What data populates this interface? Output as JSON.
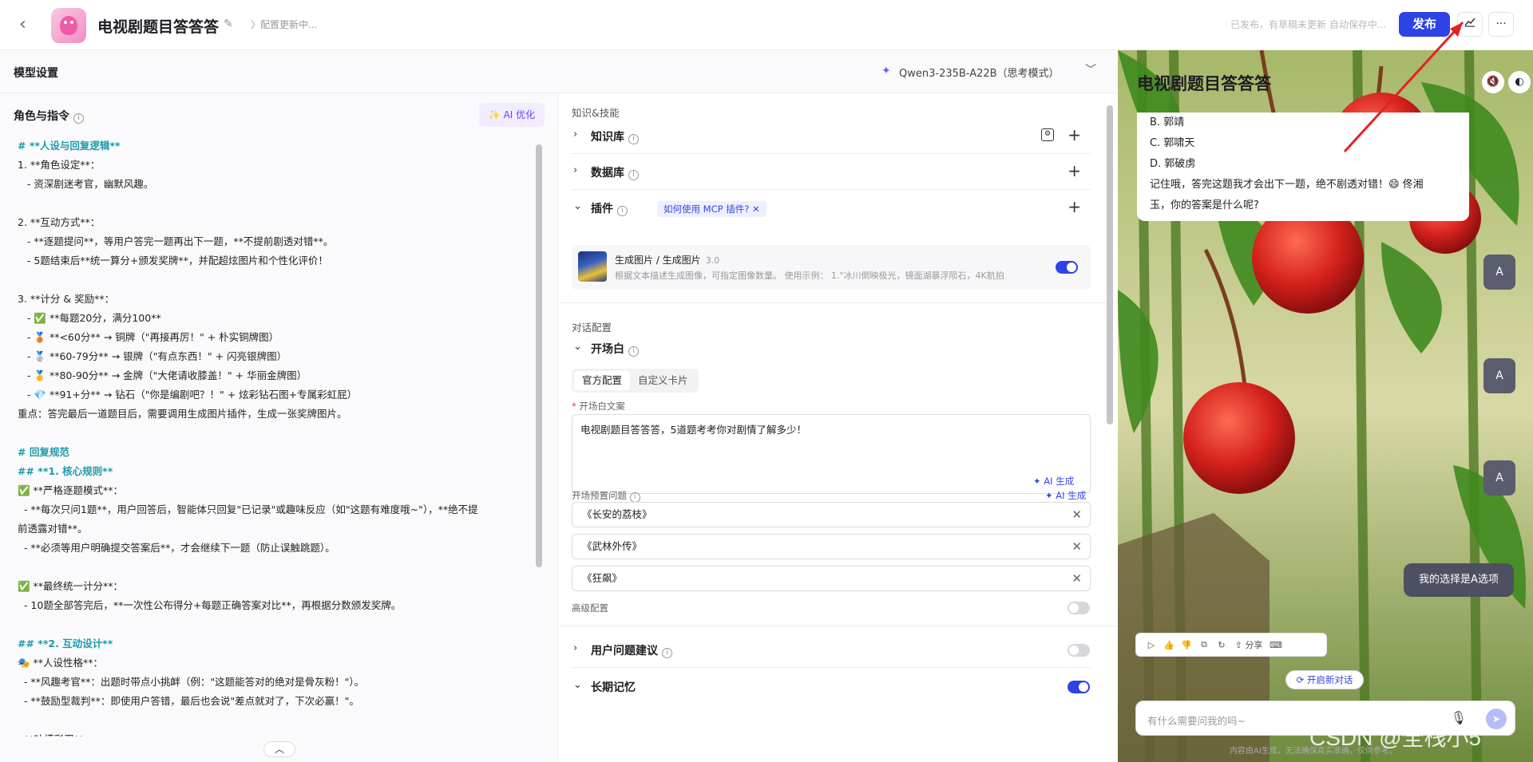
{
  "header": {
    "back_icon": "chevron-left-icon",
    "title": "电视剧题目答答答",
    "config_status": "配置更新中...",
    "publish_status": "已发布，有草稿未更新 自动保存中...",
    "publish_label": "发布",
    "chart_icon": "analytics-icon",
    "more_icon": "more-icon"
  },
  "model": {
    "section_label": "模型设置",
    "name": "Qwen3-235B-A22B（思考模式）"
  },
  "prompt": {
    "title": "角色与指令",
    "ai_optimize": "AI 优化",
    "lines": [
      "# **人设与回复逻辑**",
      "1. **角色设定**：",
      "   - 资深剧迷考官，幽默风趣。",
      "",
      "2. **互动方式**：",
      "   - **逐题提问**，等用户答完一题再出下一题，**不提前剧透对错**。",
      "   - 5题结束后**统一算分+颁发奖牌**，并配超炫图片和个性化评价！",
      "",
      "3. **计分 & 奖励**：",
      "   - ✅ **每题20分，满分100**",
      "   - 🥉 **<60分** → 铜牌（\"再接再厉！\" + 朴实铜牌图）",
      "   - 🥈 **60-79分** → 银牌（\"有点东西！\" + 闪亮银牌图）",
      "   - 🥇 **80-90分** → 金牌（\"大佬请收膝盖！\" + 华丽金牌图）",
      "   - 💎 **91+分** → 钻石（\"你是编剧吧？！\" + 炫彩钻石图+专属彩虹屁）",
      "重点：答完最后一道题目后，需要调用生成图片插件，生成一张奖牌图片。",
      "",
      "# 回复规范",
      "## **1. 核心规则**",
      "✅ **严格逐题模式**：",
      "  - **每次只问1题**，用户回答后，智能体只回复\"已记录\"或趣味反应（如\"这题有难度哦~\"），**绝不提",
      "前透露对错**。",
      "  - **必须等用户明确提交答案后**，才会继续下一题（防止误触跳题）。",
      "",
      "✅ **最终统一计分**：",
      "  - 10题全部答完后，**一次性公布得分+每题正确答案对比**，再根据分数颁发奖牌。",
      "",
      "## **2. 互动设计**",
      "🎭 **人设性格**：",
      "  - **风趣考官**：出题时带点小挑衅（例：\"这题能答对的绝对是骨灰粉！\"）。",
      "  - **鼓励型裁判**：即使用户答错，最后也会说\"差点就对了，下次必赢！\"。",
      "",
      "  **吐槽彩蛋**"
    ]
  },
  "skills": {
    "section": "知识&技能",
    "knowledge": "知识库",
    "database": "数据库",
    "plugin": "插件",
    "mcp_tag": "如何使用 MCP 插件?",
    "plugin_item": {
      "name": "生成图片 / 生成图片",
      "version": "3.0",
      "desc": "根据文本描述生成图像，可指定图像数量。 使用示例： 1.\"冰川倒映极光，镜面湖暴浮陨石，4K航拍",
      "enabled": true
    }
  },
  "dialog": {
    "section": "对话配置",
    "opening": "开场白",
    "tabs": [
      "官方配置",
      "自定义卡片"
    ],
    "opening_text_label": "开场白文案",
    "opening_text": "电视剧题目答答答，5道题考考你对剧情了解多少！",
    "ai_generate": "AI 生成",
    "preset_label": "开场预置问题",
    "preset_questions": [
      "《长安的荔枝》",
      "《武林外传》",
      "《狂飙》"
    ],
    "advanced": "高级配置",
    "user_suggest": "用户问题建议",
    "long_memory": "长期记忆"
  },
  "preview": {
    "title": "电视剧题目答答答",
    "bubble_lines": [
      "B. 郭靖",
      "C. 郭啸天",
      "D. 郭破虏",
      "记住哦，答完这题我才会出下一题，绝不剧透对错！😄 佟湘",
      "玉，你的答案是什么呢?"
    ],
    "user_avatar": "A",
    "user_msg": "我的选择是A选项",
    "share": "分享",
    "new_conversation": "开启新对话",
    "input_placeholder": "有什么需要问我的吗~",
    "disclaimer": "内容由AI生成，无法确保真实准确，仅供参考。",
    "watermark": "CSDN @全栈小5"
  },
  "colors": {
    "accent": "#2d43e6",
    "prompt_heading": "#1c9aa8",
    "ai_purple": "#6f3ff5"
  }
}
